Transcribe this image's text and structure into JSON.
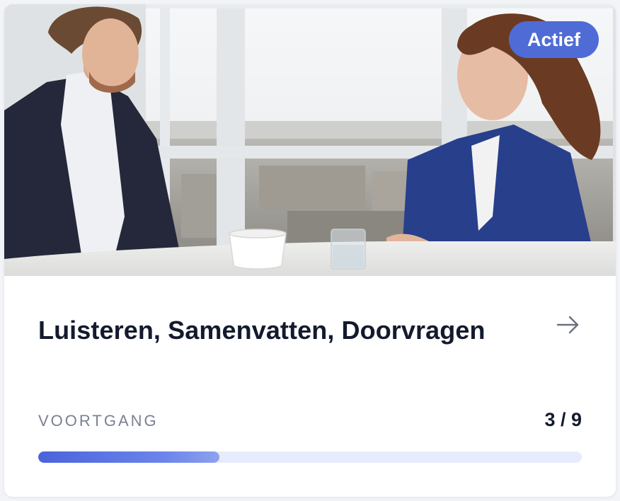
{
  "card": {
    "thumbnail_alt": "Two people talking at a table by a large window",
    "badge": "Actief",
    "title": "Luisteren, Samenvatten, Doorvragen",
    "arrow_icon": "arrow-right-icon",
    "progress": {
      "label": "VOORTGANG",
      "count_text": "3 / 9",
      "completed": 3,
      "total": 9
    },
    "colors": {
      "accent": "#4f6bd6",
      "title": "#141a2e",
      "muted": "#7b8092",
      "track": "#e6ecfb"
    }
  }
}
